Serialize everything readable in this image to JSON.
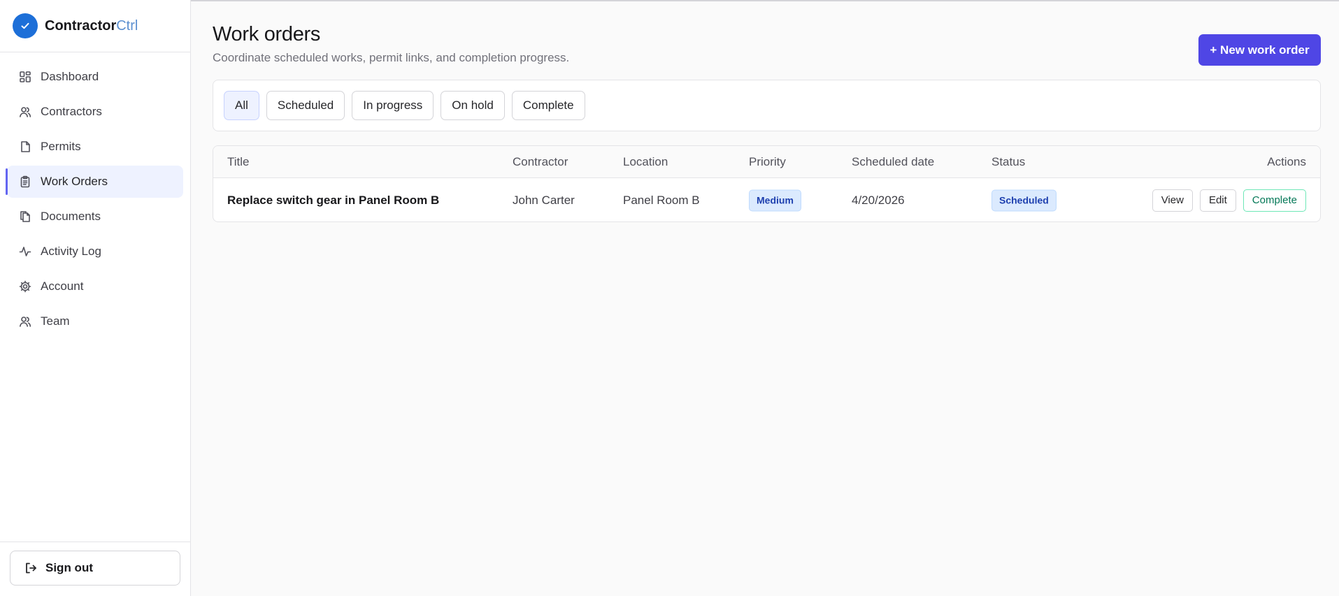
{
  "app": {
    "name": "Contractor",
    "name_suffix": "Ctrl",
    "brand_color": "#1d6fd8",
    "accent_color": "#4f46e5"
  },
  "sidebar": {
    "items": [
      {
        "label": "Dashboard",
        "icon": "dashboard-icon"
      },
      {
        "label": "Contractors",
        "icon": "users-icon"
      },
      {
        "label": "Permits",
        "icon": "file-icon"
      },
      {
        "label": "Work Orders",
        "icon": "clipboard-icon",
        "active": true
      },
      {
        "label": "Documents",
        "icon": "files-icon"
      },
      {
        "label": "Activity Log",
        "icon": "activity-icon"
      },
      {
        "label": "Account",
        "icon": "gear-icon"
      },
      {
        "label": "Team",
        "icon": "team-icon"
      }
    ],
    "sign_out_label": "Sign out"
  },
  "header": {
    "title": "Work orders",
    "subtitle": "Coordinate scheduled works, permit links, and completion progress.",
    "new_button_label": "+ New work order"
  },
  "filters": {
    "tabs": [
      "All",
      "Scheduled",
      "In progress",
      "On hold",
      "Complete"
    ],
    "selected": "All"
  },
  "table": {
    "columns": [
      "Title",
      "Contractor",
      "Location",
      "Priority",
      "Scheduled date",
      "Status",
      "Actions"
    ],
    "rows": [
      {
        "title": "Replace switch gear in Panel Room B",
        "contractor": "John Carter",
        "location": "Panel Room B",
        "priority": "Medium",
        "scheduled_date": "4/20/2026",
        "status": "Scheduled",
        "actions": [
          "View",
          "Edit",
          "Complete"
        ]
      }
    ]
  }
}
